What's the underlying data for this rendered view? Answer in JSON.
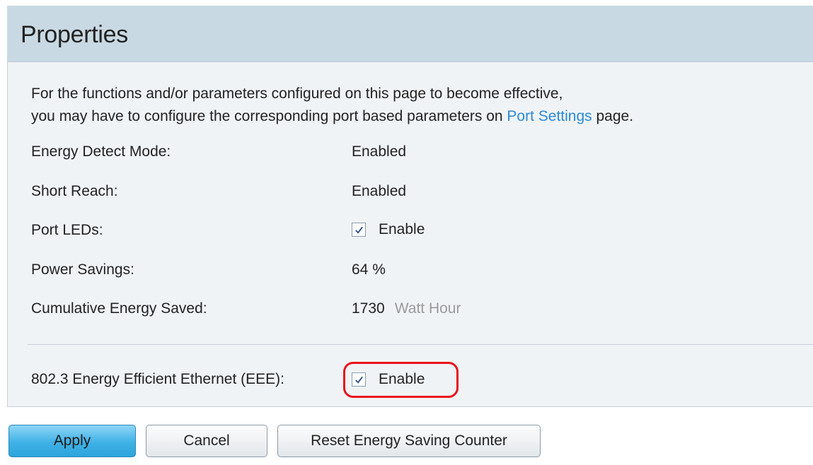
{
  "header": {
    "title": "Properties"
  },
  "intro": {
    "line1": "For the functions and/or parameters configured on this page to become effective,",
    "line2_before": "you may have to configure the corresponding port based parameters on ",
    "link_text": "Port Settings",
    "line2_after": " page."
  },
  "fields": {
    "energy_detect": {
      "label": "Energy Detect Mode:",
      "value": "Enabled"
    },
    "short_reach": {
      "label": "Short Reach:",
      "value": "Enabled"
    },
    "port_leds": {
      "label": "Port LEDs:",
      "checkbox_label": "Enable",
      "checked": true
    },
    "power_savings": {
      "label": "Power Savings:",
      "value": "64 %"
    },
    "cumulative_energy": {
      "label": "Cumulative Energy Saved:",
      "value": "1730",
      "unit": "Watt Hour"
    }
  },
  "eee": {
    "label": "802.3 Energy Efficient Ethernet (EEE):",
    "checkbox_label": "Enable",
    "checked": true,
    "highlight_color": "#e8131b"
  },
  "buttons": {
    "apply": "Apply",
    "cancel": "Cancel",
    "reset": "Reset Energy Saving Counter"
  },
  "colors": {
    "header_bg": "#c9d9e3",
    "panel_bg": "#f0f3f6",
    "link": "#2c8ad1",
    "apply_button": "#3fb1e6"
  },
  "icons": {
    "checkbox": "checkmark-icon"
  }
}
